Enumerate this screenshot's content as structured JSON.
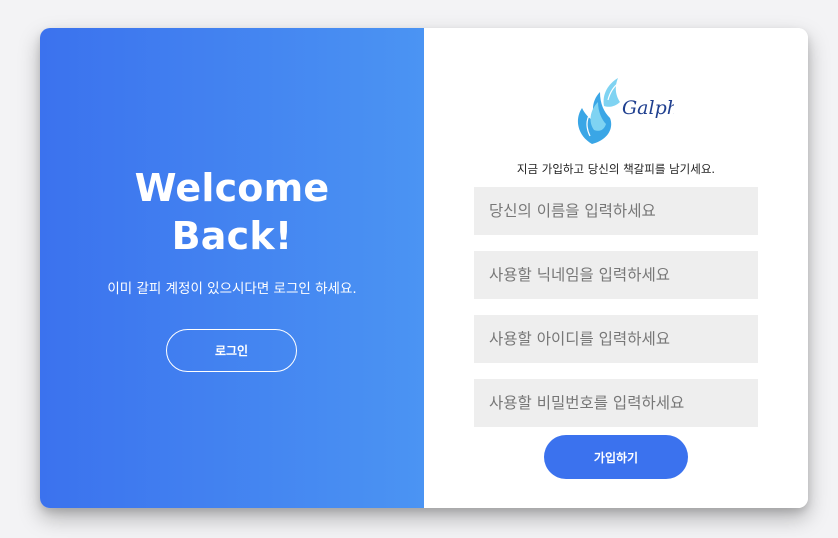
{
  "left_panel": {
    "title_line1": "Welcome",
    "title_line2": "Back!",
    "subtitle": "이미 갈피 계정이 있으시다면 로그인 하세요.",
    "login_button_label": "로그인"
  },
  "right_panel": {
    "logo_text": "Galphi",
    "tagline": "지금 가입하고 당신의 책갈피를 남기세요.",
    "fields": {
      "name_placeholder": "당신의 이름을 입력하세요",
      "nickname_placeholder": "사용할 닉네임을 입력하세요",
      "id_placeholder": "사용할 아이디를 입력하세요",
      "password_placeholder": "사용할 비밀번호를 입력하세요"
    },
    "signup_button_label": "가입하기"
  },
  "colors": {
    "gradient_start": "#3b72ee",
    "gradient_end": "#4b94f3",
    "accent": "#3b72ee",
    "input_background": "#eeeeee",
    "logo_leaf_light": "#7fd3f2",
    "logo_leaf_mid": "#3aa6e6",
    "logo_text": "#1f3f8f"
  },
  "icons": {
    "logo": "feather-flame-logo"
  }
}
